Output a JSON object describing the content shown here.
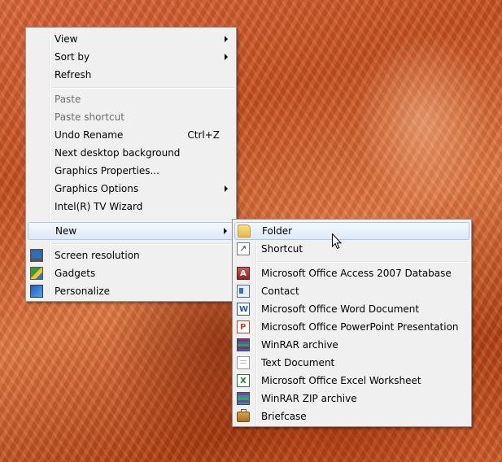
{
  "desktop_menu": {
    "view": "View",
    "sort_by": "Sort by",
    "refresh": "Refresh",
    "paste": "Paste",
    "paste_shortcut": "Paste shortcut",
    "undo_rename": "Undo Rename",
    "undo_rename_shortcut": "Ctrl+Z",
    "next_desktop_background": "Next desktop background",
    "graphics_properties": "Graphics Properties...",
    "graphics_options": "Graphics Options",
    "intel_tv_wizard": "Intel(R) TV Wizard",
    "new": "New",
    "screen_resolution": "Screen resolution",
    "gadgets": "Gadgets",
    "personalize": "Personalize"
  },
  "new_submenu": {
    "folder": "Folder",
    "shortcut": "Shortcut",
    "items": [
      {
        "label": "Microsoft Office Access 2007 Database",
        "icon": "access-icon"
      },
      {
        "label": "Contact",
        "icon": "contact-icon"
      },
      {
        "label": "Microsoft Office Word Document",
        "icon": "word-icon"
      },
      {
        "label": "Microsoft Office PowerPoint Presentation",
        "icon": "powerpoint-icon"
      },
      {
        "label": "WinRAR archive",
        "icon": "winrar-icon"
      },
      {
        "label": "Text Document",
        "icon": "text-document-icon"
      },
      {
        "label": "Microsoft Office Excel Worksheet",
        "icon": "excel-icon"
      },
      {
        "label": "WinRAR ZIP archive",
        "icon": "winrar-zip-icon"
      },
      {
        "label": "Briefcase",
        "icon": "briefcase-icon"
      }
    ]
  },
  "colors": {
    "menu_background": "#f0f0f0",
    "menu_border": "#979797",
    "hover_border": "#a8c8ee",
    "disabled_text": "#6d6d6d"
  }
}
